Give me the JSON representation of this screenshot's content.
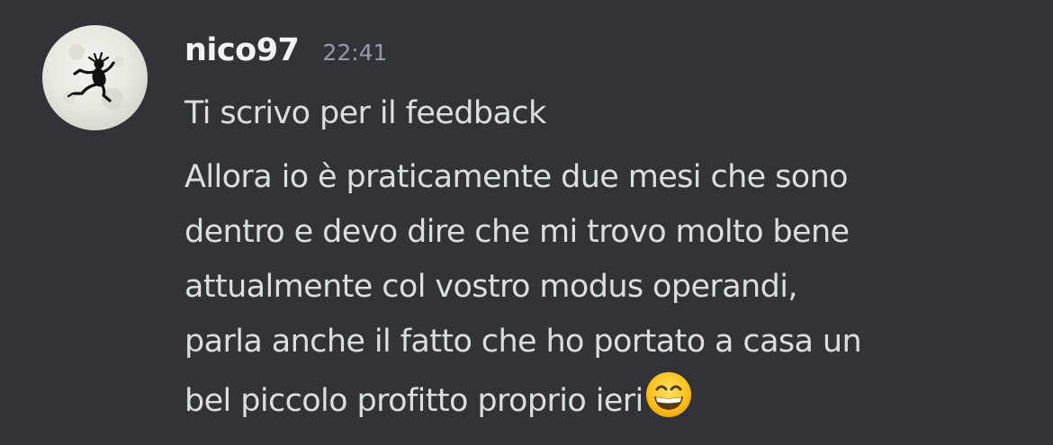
{
  "message": {
    "author": {
      "username": "nico97",
      "avatar_icon": "user-avatar-icon"
    },
    "timestamp": "22:41",
    "lines": [
      "Ti scrivo per il feedback"
    ],
    "second_message": {
      "lines": [
        "Allora io è praticamente due mesi che sono",
        "dentro e devo dire che mi trovo molto bene",
        "attualmente col vostro modus operandi,",
        "parla anche il fatto che ho portato a casa un",
        "bel piccolo profitto proprio ieri"
      ],
      "trailing_emoji": "grinning-face-with-smiling-eyes-emoji"
    }
  },
  "colors": {
    "background": "#313338",
    "username": "#f2f3f5",
    "text": "#dbdee1",
    "timestamp": "#949ba4"
  }
}
